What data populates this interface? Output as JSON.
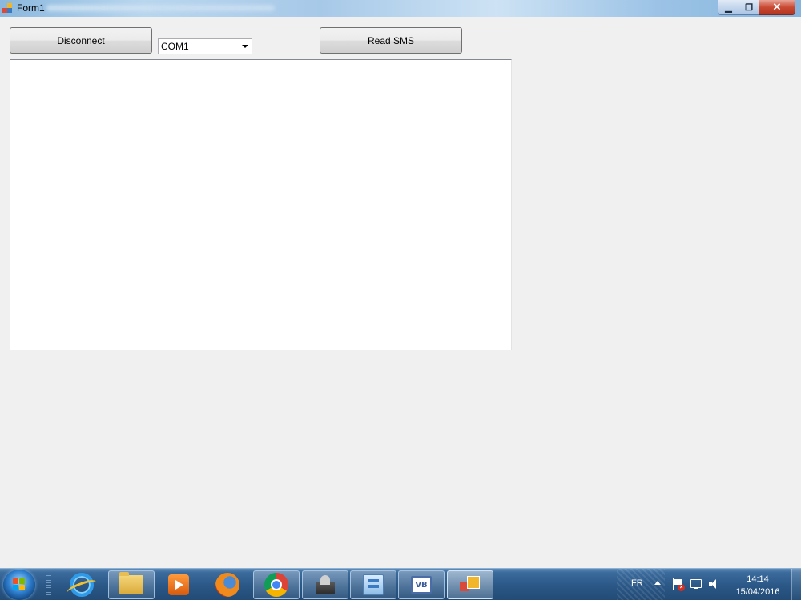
{
  "window": {
    "title": "Form1",
    "controls": {
      "minimize": "minimize",
      "maximize": "maximize",
      "close": "close"
    }
  },
  "form": {
    "disconnect_label": "Disconnect",
    "port_value": "COM1",
    "read_sms_label": "Read SMS",
    "output_text": ""
  },
  "taskbar": {
    "pinned": [
      {
        "name": "internet-explorer-icon"
      },
      {
        "name": "windows-explorer-icon"
      },
      {
        "name": "media-player-icon"
      },
      {
        "name": "firefox-icon"
      },
      {
        "name": "chrome-icon"
      },
      {
        "name": "setup-icon"
      },
      {
        "name": "network-config-icon"
      },
      {
        "name": "visual-basic-icon"
      },
      {
        "name": "form-app-icon"
      }
    ],
    "vb_badge": "VB",
    "tray": {
      "language": "FR",
      "time": "14:14",
      "date": "15/04/2016"
    }
  },
  "colors": {
    "form_background": "#f0f0f0",
    "taskbar": "#2a5786",
    "close_button": "#c94a33"
  }
}
